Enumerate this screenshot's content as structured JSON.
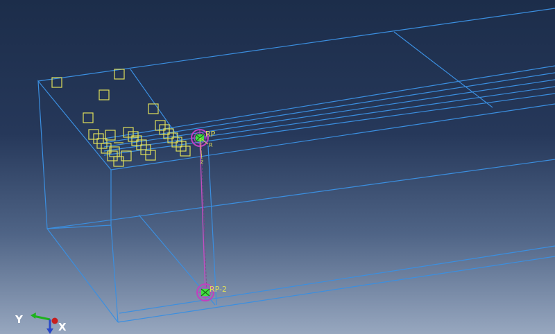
{
  "viewport": {
    "labels": {
      "rp_top": "RP",
      "rp_bottom": "RP-2",
      "local_axis_r": "R",
      "local_axis_z": "z"
    },
    "triad": {
      "y_label": "Y",
      "x_label": "X",
      "colors": {
        "y": "#1db31d",
        "z": "#2848c8",
        "x": "#c81e1e"
      }
    },
    "colors": {
      "edges": "#3b8fe0",
      "constraint_markers": "#e0e05a",
      "reference_points": "#b040b0",
      "rp_marker": "#40e040"
    }
  }
}
